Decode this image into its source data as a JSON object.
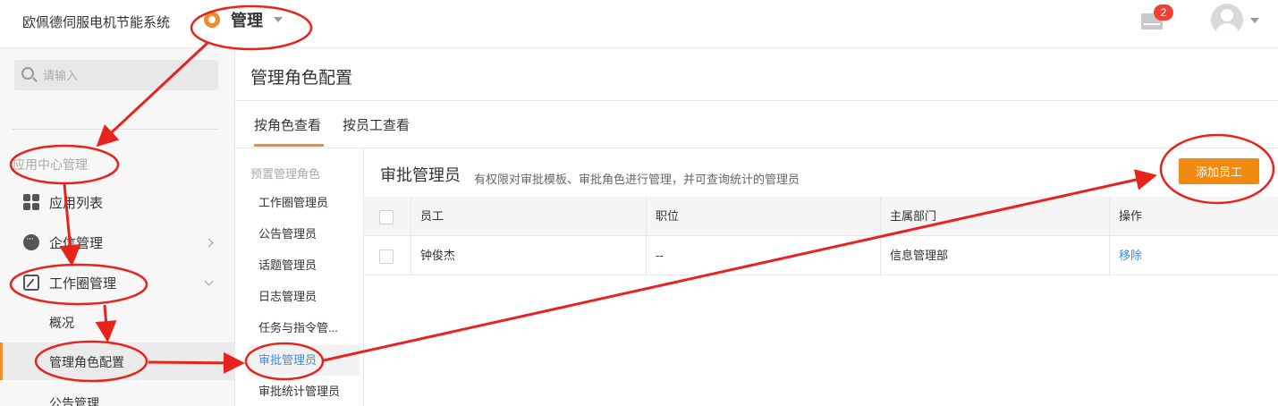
{
  "topbar": {
    "app_name": "欧佩德伺服电机节能系统",
    "module_label": "管理",
    "mail_badge": "2"
  },
  "sidebar": {
    "search_placeholder": "请输入",
    "section_title": "应用中心管理",
    "items": [
      {
        "label": "应用列表"
      },
      {
        "label": "企信管理"
      },
      {
        "label": "工作圈管理"
      }
    ],
    "sub_items": [
      {
        "label": "概况"
      },
      {
        "label": "管理角色配置"
      },
      {
        "label": "公告管理"
      }
    ]
  },
  "page": {
    "title": "管理角色配置"
  },
  "tabs": [
    {
      "label": "按角色查看"
    },
    {
      "label": "按员工查看"
    }
  ],
  "roles": {
    "group_title": "预置管理角色",
    "items": [
      {
        "label": "工作圈管理员"
      },
      {
        "label": "公告管理员"
      },
      {
        "label": "话题管理员"
      },
      {
        "label": "日志管理员"
      },
      {
        "label": "任务与指令管..."
      },
      {
        "label": "审批管理员"
      },
      {
        "label": "审批统计管理员"
      }
    ]
  },
  "detail": {
    "title": "审批管理员",
    "description": "有权限对审批模板、审批角色进行管理，并可查询统计的管理员",
    "add_button": "添加员工",
    "columns": [
      "员工",
      "职位",
      "主属部门",
      "操作"
    ],
    "rows": [
      {
        "employee": "钟俊杰",
        "position": "--",
        "department": "信息管理部",
        "action": "移除"
      }
    ]
  },
  "colors": {
    "accent": "#f28a0f",
    "link": "#3a8ee6",
    "annotation": "#e8231c"
  }
}
